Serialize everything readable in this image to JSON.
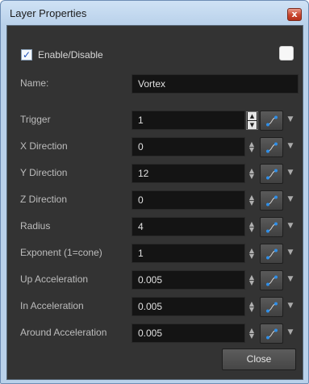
{
  "window": {
    "title": "Layer Properties",
    "close_glyph": "x"
  },
  "enable": {
    "label": "Enable/Disable",
    "checked": true,
    "check_glyph": "✓",
    "color_swatch": "#f7f7f7"
  },
  "name": {
    "label": "Name:",
    "value": "Vortex"
  },
  "params": [
    {
      "label": "Trigger",
      "value": "1",
      "stepper": "large"
    },
    {
      "label": "X Direction",
      "value": "0",
      "stepper": "small"
    },
    {
      "label": "Y Direction",
      "value": "12",
      "stepper": "small"
    },
    {
      "label": "Z Direction",
      "value": "0",
      "stepper": "small"
    },
    {
      "label": "Radius",
      "value": "4",
      "stepper": "small"
    },
    {
      "label": "Exponent (1=cone)",
      "value": "1",
      "stepper": "small"
    },
    {
      "label": "Up Acceleration",
      "value": "0.005",
      "stepper": "small"
    },
    {
      "label": "In Acceleration",
      "value": "0.005",
      "stepper": "small"
    },
    {
      "label": "Around Acceleration",
      "value": "0.005",
      "stepper": "small"
    }
  ],
  "icons": {
    "stepper_small": "up-down-arrows-icon",
    "stepper_up": "▲",
    "stepper_down": "▼",
    "function": "function-curve-icon",
    "dropdown": "▼"
  },
  "buttons": {
    "close_label": "Close"
  },
  "colors": {
    "panel_bg": "#333333",
    "field_bg": "#141414",
    "label_text": "#bcbcbc",
    "function_dot": "#2f8fe8",
    "checkbox_check": "#1c4fb8"
  }
}
